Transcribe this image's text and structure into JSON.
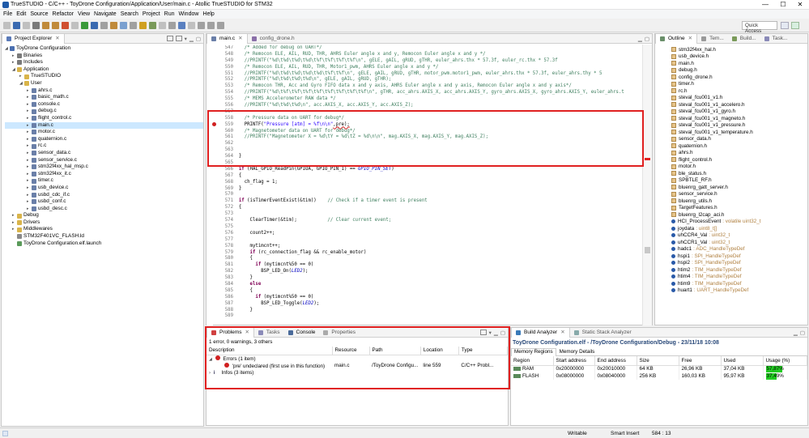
{
  "window": {
    "title": "TrueSTUDIO - C/C++ - ToyDrone Configuration/Application/User/main.c - Atollic TrueSTUDIO for STM32",
    "min": "—",
    "max": "☐",
    "close": "✕"
  },
  "menu": [
    "File",
    "Edit",
    "Source",
    "Refactor",
    "View",
    "Navigate",
    "Search",
    "Project",
    "Run",
    "Window",
    "Help"
  ],
  "toolbar": {
    "quick_access": "Quick Access"
  },
  "project_explorer": {
    "tab": "Project Explorer",
    "items": [
      {
        "label": "ToyDrone Configuration",
        "indent": 0,
        "arrow": "◢",
        "icon": "project-icon",
        "color": "#4a6fb0"
      },
      {
        "label": "Binaries",
        "indent": 1,
        "arrow": "▸",
        "icon": "binaries-icon",
        "color": "#7a7a7a"
      },
      {
        "label": "Includes",
        "indent": 1,
        "arrow": "▸",
        "icon": "includes-icon",
        "color": "#7a7a7a"
      },
      {
        "label": "Application",
        "indent": 1,
        "arrow": "◢",
        "icon": "folder-icon",
        "color": "#d9b44a"
      },
      {
        "label": "TrueSTUDIO",
        "indent": 2,
        "arrow": "▸",
        "icon": "folder-icon",
        "color": "#d9b44a"
      },
      {
        "label": "User",
        "indent": 2,
        "arrow": "◢",
        "icon": "folder-icon",
        "color": "#d9b44a"
      },
      {
        "label": "ahrs.c",
        "indent": 3,
        "arrow": "▸",
        "icon": "c-file-icon",
        "color": "#6a7fa8"
      },
      {
        "label": "basic_math.c",
        "indent": 3,
        "arrow": "▸",
        "icon": "c-file-icon",
        "color": "#6a7fa8"
      },
      {
        "label": "console.c",
        "indent": 3,
        "arrow": "▸",
        "icon": "c-file-icon",
        "color": "#6a7fa8"
      },
      {
        "label": "debug.c",
        "indent": 3,
        "arrow": "▸",
        "icon": "c-file-icon",
        "color": "#6a7fa8"
      },
      {
        "label": "flight_control.c",
        "indent": 3,
        "arrow": "▸",
        "icon": "c-file-icon",
        "color": "#6a7fa8"
      },
      {
        "label": "main.c",
        "indent": 3,
        "arrow": "▸",
        "icon": "c-file-icon",
        "color": "#6a7fa8",
        "selected": true
      },
      {
        "label": "motor.c",
        "indent": 3,
        "arrow": "▸",
        "icon": "c-file-icon",
        "color": "#6a7fa8"
      },
      {
        "label": "quaternion.c",
        "indent": 3,
        "arrow": "▸",
        "icon": "c-file-icon",
        "color": "#6a7fa8"
      },
      {
        "label": "rc.c",
        "indent": 3,
        "arrow": "▸",
        "icon": "c-file-icon",
        "color": "#6a7fa8"
      },
      {
        "label": "sensor_data.c",
        "indent": 3,
        "arrow": "▸",
        "icon": "c-file-icon",
        "color": "#6a7fa8"
      },
      {
        "label": "sensor_service.c",
        "indent": 3,
        "arrow": "▸",
        "icon": "c-file-icon",
        "color": "#6a7fa8"
      },
      {
        "label": "stm32f4xx_hal_msp.c",
        "indent": 3,
        "arrow": "▸",
        "icon": "c-file-icon",
        "color": "#6a7fa8"
      },
      {
        "label": "stm32f4xx_it.c",
        "indent": 3,
        "arrow": "▸",
        "icon": "c-file-icon",
        "color": "#6a7fa8"
      },
      {
        "label": "timer.c",
        "indent": 3,
        "arrow": "▸",
        "icon": "c-file-icon",
        "color": "#6a7fa8"
      },
      {
        "label": "usb_device.c",
        "indent": 3,
        "arrow": "▸",
        "icon": "c-file-icon",
        "color": "#6a7fa8"
      },
      {
        "label": "usbd_cdc_if.c",
        "indent": 3,
        "arrow": "▸",
        "icon": "c-file-icon",
        "color": "#6a7fa8"
      },
      {
        "label": "usbd_conf.c",
        "indent": 3,
        "arrow": "▸",
        "icon": "c-file-icon",
        "color": "#6a7fa8"
      },
      {
        "label": "usbd_desc.c",
        "indent": 3,
        "arrow": "▸",
        "icon": "c-file-icon",
        "color": "#6a7fa8"
      },
      {
        "label": "Debug",
        "indent": 1,
        "arrow": "▸",
        "icon": "folder-icon",
        "color": "#d9b44a"
      },
      {
        "label": "Drivers",
        "indent": 1,
        "arrow": "▸",
        "icon": "folder-icon",
        "color": "#d9b44a"
      },
      {
        "label": "Middlewares",
        "indent": 1,
        "arrow": "▸",
        "icon": "folder-icon",
        "color": "#d9b44a"
      },
      {
        "label": "STM32F401VC_FLASH.ld",
        "indent": 1,
        "arrow": "",
        "icon": "ld-file-icon",
        "color": "#8a8a8a"
      },
      {
        "label": "ToyDrone Configuration.elf.launch",
        "indent": 1,
        "arrow": "",
        "icon": "launch-icon",
        "color": "#5a9a5a"
      }
    ]
  },
  "editor": {
    "tabs": [
      {
        "label": "main.c",
        "active": true
      },
      {
        "label": "config_drone.h",
        "active": false
      }
    ],
    "lines": [
      {
        "n": "547",
        "segs": [
          [
            "cm",
            "    /* Added for debug on UART*/"
          ]
        ]
      },
      {
        "n": "548",
        "segs": [
          [
            "cm",
            "    /* Remocon ELE, AIL, RUD, THR, AHRS Euler angle x and y, Remocon Euler angle x and y */"
          ]
        ]
      },
      {
        "n": "549",
        "segs": [
          [
            "cm",
            "    //PRINTF(\"%d\\t%d\\t%d\\t%d\\t%f\\t%f\\t%f\\t%f\\n\", gELE, gAIL, gRUD, gTHR, euler_ahrs.thx * 57.3f, euler_rc.thx * 57.3f"
          ]
        ]
      },
      {
        "n": "550",
        "segs": [
          [
            "cm",
            "    /* Remocon ELE, AIL, RUD, THR, Motor1_pwm, AHRS Euler angle x and y */"
          ]
        ]
      },
      {
        "n": "551",
        "segs": [
          [
            "cm",
            "    //PRINTF(\"%d\\t%d\\t%d\\t%d\\t%d\\t%f\\t%f\\n\", gELE, gAIL, gRUD, gTHR, motor_pwm.motor1_pwm, euler_ahrs.thx * 57.3f, euler_ahrs.thy * 5"
          ]
        ]
      },
      {
        "n": "552",
        "segs": [
          [
            "cm",
            "    //PRINTF(\"%d\\t%d\\t%d\\t%d\\n\", gELE, gAIL, gRUD, gTHR);"
          ]
        ]
      },
      {
        "n": "553",
        "segs": [
          [
            "cm",
            "    /* Remocon THR, Acc and Gyro FIFO data x and y axis, AHRS Euler angle x and y axis, Remocon Euler angle x and y axis*/"
          ]
        ]
      },
      {
        "n": "554",
        "segs": [
          [
            "cm",
            "    //PRINTF(\"%d\\t%f\\t%f\\t%f\\t%f\\t%f\\t%f\\t%f\\t%f\\n\", gTHR, acc_ahrs.AXIS_X, acc_ahrs.AXIS_Y, gyro_ahrs.AXIS_X, gyro_ahrs.AXIS_Y, euler_ahrs.t"
          ]
        ]
      },
      {
        "n": "555",
        "segs": [
          [
            "cm",
            "    /* MEMS Accelerometer RAW data */"
          ]
        ]
      },
      {
        "n": "556",
        "segs": [
          [
            "cm",
            "    //PRINTF(\"%d\\t%d\\t%d\\n\", acc.AXIS_X, acc.AXIS_Y, acc.AXIS_Z);"
          ]
        ]
      },
      {
        "n": "557",
        "segs": [
          [
            "",
            ""
          ]
        ]
      },
      {
        "n": "558",
        "segs": [
          [
            "cm",
            "    /* Pressure data on UART for debug*/"
          ]
        ]
      },
      {
        "n": "559",
        "segs": [
          [
            "",
            "    PRINTF("
          ],
          [
            "str",
            "\"Pressure [atm] = %f\\n\\n\""
          ],
          [
            "",
            ",pre);"
          ]
        ],
        "error": true
      },
      {
        "n": "560",
        "segs": [
          [
            "cm",
            "    /* Magnetometer data on UART for debug*/"
          ]
        ]
      },
      {
        "n": "561",
        "segs": [
          [
            "cm",
            "    //PRINTF(\"Magnetometer X = %d\\tY = %d\\tZ = %d\\n\\n\", mag.AXIS_X, mag.AXIS_Y, mag.AXIS_Z);"
          ]
        ]
      },
      {
        "n": "562",
        "segs": [
          [
            "",
            ""
          ]
        ]
      },
      {
        "n": "563",
        "segs": [
          [
            "",
            ""
          ]
        ]
      },
      {
        "n": "564",
        "segs": [
          [
            "",
            "  }"
          ]
        ]
      },
      {
        "n": "565",
        "segs": [
          [
            "",
            ""
          ]
        ]
      },
      {
        "n": "566",
        "segs": [
          [
            "kw",
            "  if"
          ],
          [
            "",
            " (HAL_GPIO_ReadPin(GPIOA, GPIO_PIN_1) == "
          ],
          [
            "mac",
            "GPIO_PIN_SET"
          ],
          [
            "",
            ")"
          ]
        ]
      },
      {
        "n": "567",
        "segs": [
          [
            "",
            "  {"
          ]
        ]
      },
      {
        "n": "568",
        "segs": [
          [
            "",
            "    ch_flag = 1;"
          ]
        ]
      },
      {
        "n": "569",
        "segs": [
          [
            "",
            "  }"
          ]
        ]
      },
      {
        "n": "570",
        "segs": [
          [
            "",
            ""
          ]
        ]
      },
      {
        "n": "571",
        "segs": [
          [
            "kw",
            "  if"
          ],
          [
            "",
            " (isTimerEventExist(&tim))    "
          ],
          [
            "cm",
            "// Check if a timer event is present"
          ]
        ]
      },
      {
        "n": "572",
        "segs": [
          [
            "",
            "  {"
          ]
        ]
      },
      {
        "n": "573",
        "segs": [
          [
            "",
            ""
          ]
        ]
      },
      {
        "n": "574",
        "segs": [
          [
            "",
            "      ClearTimer(&tim);           "
          ],
          [
            "cm",
            "// Clear current event;"
          ]
        ]
      },
      {
        "n": "575",
        "segs": [
          [
            "",
            ""
          ]
        ]
      },
      {
        "n": "576",
        "segs": [
          [
            "",
            "      count2++;"
          ]
        ]
      },
      {
        "n": "577",
        "segs": [
          [
            "",
            ""
          ]
        ]
      },
      {
        "n": "578",
        "segs": [
          [
            "",
            "      mytimcnt++;"
          ]
        ]
      },
      {
        "n": "579",
        "segs": [
          [
            "kw",
            "      if"
          ],
          [
            "",
            " (rc_connection_flag && rc_enable_motor)"
          ]
        ]
      },
      {
        "n": "580",
        "segs": [
          [
            "",
            "      {"
          ]
        ]
      },
      {
        "n": "581",
        "segs": [
          [
            "kw",
            "        if"
          ],
          [
            "",
            " (mytimcnt%50 == 0)"
          ]
        ]
      },
      {
        "n": "582",
        "segs": [
          [
            "",
            "          BSP_LED_On("
          ],
          [
            "mac",
            "LED2"
          ],
          [
            "",
            ");"
          ]
        ]
      },
      {
        "n": "583",
        "segs": [
          [
            "",
            "      }"
          ]
        ]
      },
      {
        "n": "584",
        "segs": [
          [
            "kw",
            "      else"
          ]
        ]
      },
      {
        "n": "585",
        "segs": [
          [
            "",
            "      {"
          ]
        ]
      },
      {
        "n": "586",
        "segs": [
          [
            "kw",
            "        if"
          ],
          [
            "",
            " (mytimcnt%50 == 0)"
          ]
        ]
      },
      {
        "n": "587",
        "segs": [
          [
            "",
            "          BSP_LED_Toggle("
          ],
          [
            "mac",
            "LED2"
          ],
          [
            "",
            ");"
          ]
        ]
      },
      {
        "n": "588",
        "segs": [
          [
            "",
            "      }"
          ]
        ]
      },
      {
        "n": "589",
        "segs": [
          [
            "",
            ""
          ]
        ]
      }
    ]
  },
  "outline": {
    "tabs": [
      "Outline",
      "Tem...",
      "Build...",
      "Task..."
    ],
    "items": [
      {
        "label": "stm32f4xx_hal.h",
        "kind": "include"
      },
      {
        "label": "usb_device.h",
        "kind": "include"
      },
      {
        "label": "main.h",
        "kind": "include"
      },
      {
        "label": "debug.h",
        "kind": "include"
      },
      {
        "label": "config_drone.h",
        "kind": "include"
      },
      {
        "label": "timer.h",
        "kind": "include"
      },
      {
        "label": "rc.h",
        "kind": "include"
      },
      {
        "label": "steval_fcu001_v1.h",
        "kind": "include"
      },
      {
        "label": "steval_fcu001_v1_accelero.h",
        "kind": "include"
      },
      {
        "label": "steval_fcu001_v1_gyro.h",
        "kind": "include"
      },
      {
        "label": "steval_fcu001_v1_magneto.h",
        "kind": "include"
      },
      {
        "label": "steval_fcu001_v1_pressure.h",
        "kind": "include"
      },
      {
        "label": "steval_fcu001_v1_temperature.h",
        "kind": "include"
      },
      {
        "label": "sensor_data.h",
        "kind": "include"
      },
      {
        "label": "quaternion.h",
        "kind": "include"
      },
      {
        "label": "ahrs.h",
        "kind": "include"
      },
      {
        "label": "flight_control.h",
        "kind": "include"
      },
      {
        "label": "motor.h",
        "kind": "include"
      },
      {
        "label": "ble_status.h",
        "kind": "include"
      },
      {
        "label": "SPBTLE_RF.h",
        "kind": "include"
      },
      {
        "label": "bluenrg_gatt_server.h",
        "kind": "include"
      },
      {
        "label": "sensor_service.h",
        "kind": "include"
      },
      {
        "label": "bluenrg_utils.h",
        "kind": "include"
      },
      {
        "label": "TargetFeatures.h",
        "kind": "include"
      },
      {
        "label": "bluenrg_l2cap_aci.h",
        "kind": "include"
      },
      {
        "label": "HCI_ProcessEvent",
        "type": ": volatile uint32_t",
        "kind": "var"
      },
      {
        "label": "joydata",
        "type": ": uint8_t[]",
        "kind": "var"
      },
      {
        "label": "uhCCR4_Val",
        "type": ": uint32_t",
        "kind": "var"
      },
      {
        "label": "uhCCR1_Val",
        "type": ": uint32_t",
        "kind": "var"
      },
      {
        "label": "hadc1",
        "type": ": ADC_HandleTypeDef",
        "kind": "var"
      },
      {
        "label": "hspi1",
        "type": ": SPI_HandleTypeDef",
        "kind": "var"
      },
      {
        "label": "hspi2",
        "type": ": SPI_HandleTypeDef",
        "kind": "var"
      },
      {
        "label": "htim2",
        "type": ": TIM_HandleTypeDef",
        "kind": "var"
      },
      {
        "label": "htim4",
        "type": ": TIM_HandleTypeDef",
        "kind": "var"
      },
      {
        "label": "htim9",
        "type": ": TIM_HandleTypeDef",
        "kind": "var"
      },
      {
        "label": "huart1",
        "type": ": UART_HandleTypeDef",
        "kind": "var"
      }
    ]
  },
  "problems": {
    "tabs": [
      "Problems",
      "Tasks",
      "Console",
      "Properties"
    ],
    "summary": "1 error, 0 warnings, 3 others",
    "columns": [
      "Description",
      "Resource",
      "Path",
      "Location",
      "Type"
    ],
    "errors_group": "Errors (1 item)",
    "error": {
      "description": "'pre' undeclared (first use in this function)",
      "resource": "main.c",
      "path": "/ToyDrone Configu...",
      "location": "line 559",
      "type": "C/C++ Probl..."
    },
    "infos_group": "Infos (3 items)"
  },
  "build_analyzer": {
    "tabs": [
      "Build Analyzer",
      "Static Stack Analyzer"
    ],
    "header": "ToyDrone Configuration.elf - /ToyDrone Configuration/Debug - 23/11/18 10:08",
    "subtabs": [
      "Memory Regions",
      "Memory Details"
    ],
    "columns": [
      "Region",
      "Start address",
      "End address",
      "Size",
      "Free",
      "Used",
      "Usage (%)"
    ],
    "rows": [
      {
        "region": "RAM",
        "start": "0x20000000",
        "end": "0x20010000",
        "size": "64 KB",
        "free": "26,96 KB",
        "used": "37,04 KB",
        "usage": "57,87%",
        "pct": 0.5787
      },
      {
        "region": "FLASH",
        "start": "0x08000000",
        "end": "0x08040000",
        "size": "256 KB",
        "free": "160,03 KB",
        "used": "95,97 KB",
        "usage": "37,49%",
        "pct": 0.3749
      }
    ]
  },
  "status": {
    "writable": "Writable",
    "insert": "Smart Insert",
    "position": "584 : 13"
  },
  "colors": {
    "highlight": "#e02020",
    "usage_green": "#22cc22",
    "selection": "#cce8ff"
  }
}
